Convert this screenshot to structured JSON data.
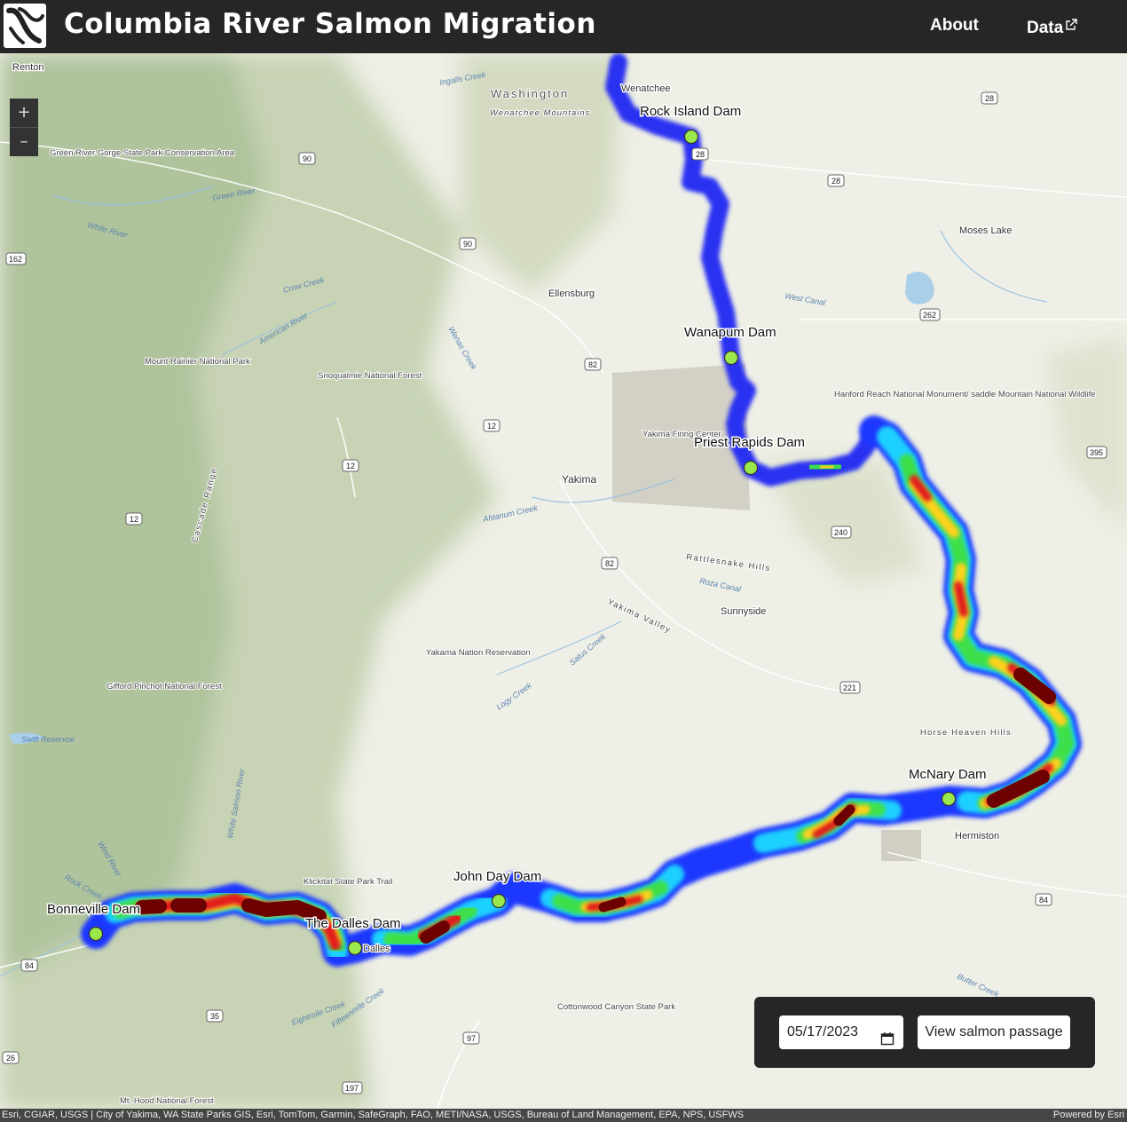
{
  "header": {
    "title": "Columbia River Salmon Migration",
    "nav": {
      "about": "About",
      "data": "Data"
    }
  },
  "icons": {
    "logo": "salmon-logo-icon",
    "external": "external-link-icon",
    "calendar": "calendar-icon"
  },
  "zoom": {
    "in": "+",
    "out": "–"
  },
  "controls": {
    "date_value": "05/17/2023",
    "button_label": "View salmon passage"
  },
  "colors": {
    "header_bg": "#262626",
    "dam_marker": "#9be84c",
    "heat_low": "#1f2cff",
    "heat_high": "#7a0000"
  },
  "map": {
    "dams": [
      {
        "name": "Rock Island Dam"
      },
      {
        "name": "Wanapum Dam"
      },
      {
        "name": "Priest Rapids Dam"
      },
      {
        "name": "McNary Dam"
      },
      {
        "name": "John Day Dam"
      },
      {
        "name": "The Dalles Dam"
      },
      {
        "name": "Bonneville Dam"
      }
    ],
    "places": [
      "Renton",
      "Wenatchee",
      "Ellensburg",
      "Yakima",
      "Sunnyside",
      "Moses Lake",
      "Hermiston",
      "Dalles"
    ],
    "regions": [
      "Washington",
      "Wenatchee Mountains",
      "Rattlesnake Hills",
      "Yakima Valley",
      "Horse Heaven Hills",
      "Cascade Range"
    ],
    "areas": [
      "Mount Rainier National Park",
      "Snoqualmie National Forest",
      "Gifford Pinchot National Forest",
      "Green River Gorge State Park Conservation Area",
      "Yakama Nation Reservation",
      "Yakima Firing Center",
      "Hanford Reach National Monument/ saddle Mountain National Wildlife",
      "Klickitat State Park Trail",
      "Cottonwood Canyon State Park",
      "Swift Reservoir",
      "Mt. Hood National Forest"
    ],
    "waters": [
      "Green River",
      "White River",
      "Crow Creek",
      "American River",
      "Wenas Creek",
      "Ahtanum Creek",
      "Roza Canal",
      "Satus Creek",
      "Logy Creek",
      "West Canal",
      "Rock Creek",
      "Wind River",
      "White Salmon River",
      "Eightmile Creek",
      "Fifteenmile Creek",
      "Butter Creek",
      "Ingalls Creek"
    ],
    "highways": [
      "90",
      "82",
      "12",
      "28",
      "240",
      "262",
      "395",
      "221",
      "84",
      "97",
      "35",
      "26",
      "197",
      "162"
    ]
  },
  "attribution": {
    "left": "Esri, CGIAR, USGS | City of Yakima, WA State Parks GIS, Esri, TomTom, Garmin, SafeGraph, FAO, METI/NASA, USGS, Bureau of Land Management, EPA, NPS, USFWS",
    "right": "Powered by Esri"
  }
}
